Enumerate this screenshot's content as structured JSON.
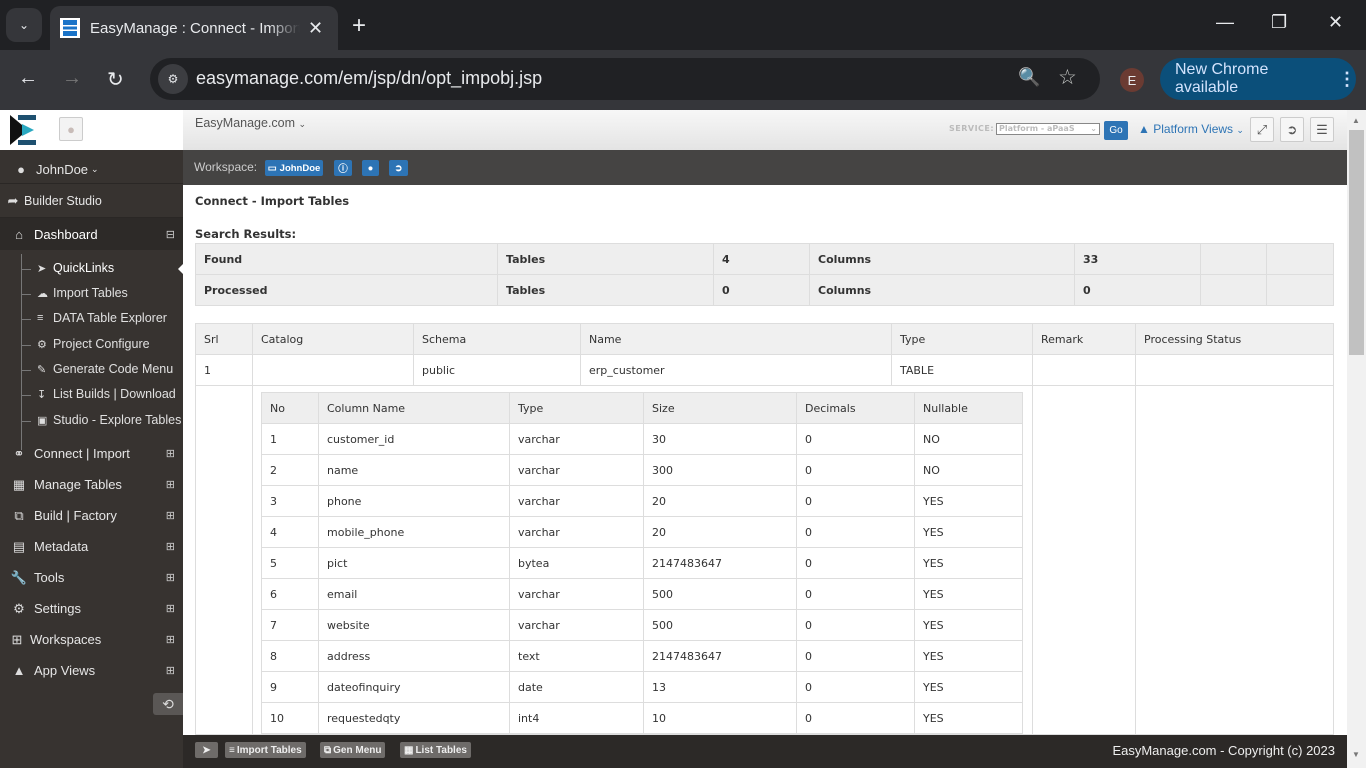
{
  "browser": {
    "tab_title": "EasyManage : Connect - Import Tables",
    "url": "easymanage.com/em/jsp/dn/opt_impobj.jsp",
    "profile_initial": "E",
    "update_label": "New Chrome available"
  },
  "topbar": {
    "brand": "EasyManage.com",
    "service_label": "SERVICE:",
    "service_value": "Platform - aPaaS",
    "go_label": "Go",
    "platform_views": "Platform Views"
  },
  "workspace": {
    "label": "Workspace:",
    "user": "JohnDoe"
  },
  "sidebar": {
    "user": "JohnDoe",
    "builder": "Builder Studio",
    "dashboard": "Dashboard",
    "sub_items": [
      {
        "label": "QuickLinks",
        "icon": "paper-plane-icon"
      },
      {
        "label": "Import Tables",
        "icon": "cloud-download-icon"
      },
      {
        "label": "DATA Table Explorer",
        "icon": "database-icon"
      },
      {
        "label": "Project Configure",
        "icon": "gear-icon"
      },
      {
        "label": "Generate Code Menu",
        "icon": "edit-icon"
      },
      {
        "label": "List Builds | Download",
        "icon": "download-icon"
      },
      {
        "label": "Studio - Explore Tables",
        "icon": "briefcase-icon"
      }
    ],
    "sections": [
      {
        "label": "Connect | Import",
        "icon": "link-icon"
      },
      {
        "label": "Manage Tables",
        "icon": "table-icon"
      },
      {
        "label": "Build | Factory",
        "icon": "external-link-icon"
      },
      {
        "label": "Metadata",
        "icon": "book-icon"
      },
      {
        "label": "Tools",
        "icon": "wrench-icon"
      },
      {
        "label": "Settings",
        "icon": "gears-icon"
      },
      {
        "label": "Workspaces",
        "icon": "plus-square-icon"
      },
      {
        "label": "App Views",
        "icon": "puzzle-icon"
      }
    ]
  },
  "page": {
    "title": "Connect - Import Tables",
    "search_results_label": "Search Results:",
    "summary": [
      {
        "label": "Found",
        "tables_label": "Tables",
        "tables": "4",
        "columns_label": "Columns",
        "columns": "33"
      },
      {
        "label": "Processed",
        "tables_label": "Tables",
        "tables": "0",
        "columns_label": "Columns",
        "columns": "0"
      }
    ],
    "main_headers": [
      "Srl",
      "Catalog",
      "Schema",
      "Name",
      "Type",
      "Remark",
      "Processing Status"
    ],
    "main_row": {
      "srl": "1",
      "catalog": "",
      "schema": "public",
      "name": "erp_customer",
      "type": "TABLE",
      "remark": "",
      "status": ""
    },
    "column_headers": [
      "No",
      "Column Name",
      "Type",
      "Size",
      "Decimals",
      "Nullable"
    ],
    "columns": [
      [
        "1",
        "customer_id",
        "varchar",
        "30",
        "0",
        "NO"
      ],
      [
        "2",
        "name",
        "varchar",
        "300",
        "0",
        "NO"
      ],
      [
        "3",
        "phone",
        "varchar",
        "20",
        "0",
        "YES"
      ],
      [
        "4",
        "mobile_phone",
        "varchar",
        "20",
        "0",
        "YES"
      ],
      [
        "5",
        "pict",
        "bytea",
        "2147483647",
        "0",
        "YES"
      ],
      [
        "6",
        "email",
        "varchar",
        "500",
        "0",
        "YES"
      ],
      [
        "7",
        "website",
        "varchar",
        "500",
        "0",
        "YES"
      ],
      [
        "8",
        "address",
        "text",
        "2147483647",
        "0",
        "YES"
      ],
      [
        "9",
        "dateofinquiry",
        "date",
        "13",
        "0",
        "YES"
      ],
      [
        "10",
        "requestedqty",
        "int4",
        "10",
        "0",
        "YES"
      ]
    ]
  },
  "footer": {
    "buttons": [
      "Import Tables",
      "Gen Menu",
      "List Tables"
    ],
    "copyright": "EasyManage.com - Copyright (c) 2023"
  }
}
